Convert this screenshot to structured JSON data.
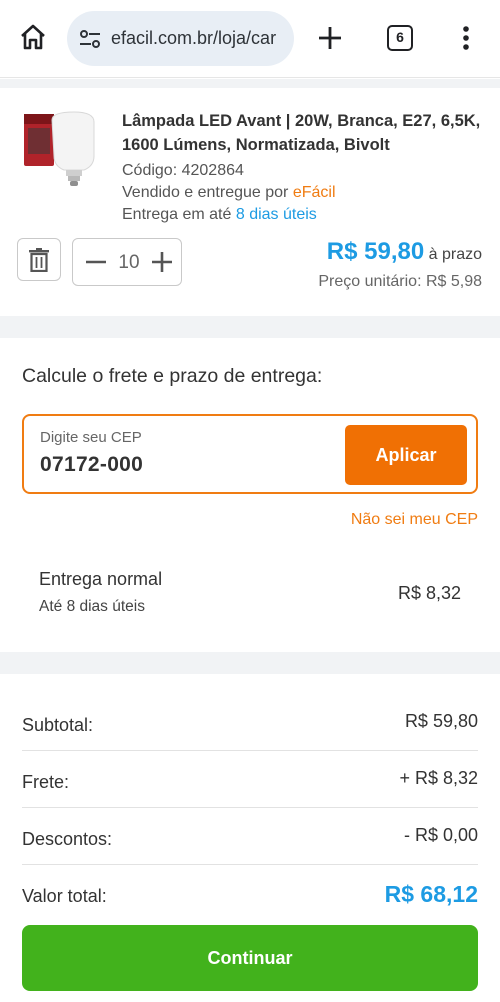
{
  "browser": {
    "url": "efacil.com.br/loja/car",
    "tabs_count": "6",
    "icons": [
      "home-icon",
      "site-settings-icon",
      "plus-icon",
      "tab-switcher-icon",
      "more-vert-icon"
    ]
  },
  "product": {
    "title": "Lâmpada LED Avant | 20W, Branca, E27, 6,5K, 1600 Lúmens, Normatizada, Bivolt",
    "code": "Código: 4202864",
    "sold_by_prefix": "Vendido e entregue por ",
    "seller": "eFácil",
    "delivery_prefix": "Entrega em até ",
    "delivery_days": "8 dias úteis",
    "quantity": "10",
    "price": "R$ 59,80",
    "price_suffix": " à prazo",
    "unit_price": "Preço unitário: R$ 5,98"
  },
  "freight": {
    "title": "Calcule o frete e prazo de entrega:",
    "cep_label": "Digite seu CEP",
    "cep_value": "07172-000",
    "apply_label": "Aplicar",
    "unknown_cep_link": "Não sei meu CEP",
    "option_name": "Entrega normal",
    "option_days": "Até 8 dias úteis",
    "option_price": "R$ 8,32"
  },
  "summary": {
    "subtotal_label": "Subtotal:",
    "subtotal_value": "R$ 59,80",
    "freight_label": "Frete:",
    "freight_value": "+ R$ 8,32",
    "discount_label": "Descontos:",
    "discount_value": "- R$ 0,00",
    "total_label": "Valor total:",
    "total_value": "R$ 68,12",
    "continue_label": "Continuar"
  },
  "colors": {
    "accent_blue": "#1d9be3",
    "accent_orange": "#f07c12",
    "button_orange": "#f07004",
    "button_green": "#42b21c"
  }
}
